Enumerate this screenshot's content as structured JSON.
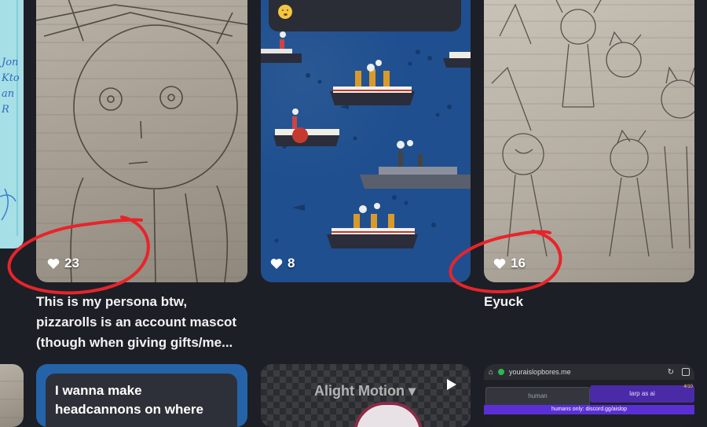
{
  "cards": [
    {
      "id": "persona",
      "likes": "23",
      "caption": [
        "This is my persona btw,",
        "pizzarolls is an account mascot",
        "(though when giving gifts/me..."
      ]
    },
    {
      "id": "ships",
      "likes": "8",
      "caption": []
    },
    {
      "id": "eyuck",
      "likes": "16",
      "caption": [
        "Eyuck"
      ]
    }
  ],
  "side_left_text": [
    "Jon",
    "Kto",
    "an",
    "R"
  ],
  "bottom_row": {
    "text_card": {
      "lines": [
        "I wanna make",
        "headcannons on where"
      ]
    },
    "video_card": {
      "watermark": "Alight Motion"
    },
    "browser_card": {
      "url": "youraislopbores.me",
      "tab_left": "human",
      "tab_right": "larp as ai",
      "banner": "humans only: discord.gg/aislop",
      "corner": "4/10"
    }
  },
  "icons": [
    "heart-icon",
    "play-icon",
    "home-icon",
    "shield-icon",
    "refresh-icon",
    "tabs-icon",
    "emoji-icon"
  ],
  "colors": {
    "background": "#1d1f26",
    "annotation_red": "#e8242b",
    "ocean": "#1f4f8f"
  }
}
